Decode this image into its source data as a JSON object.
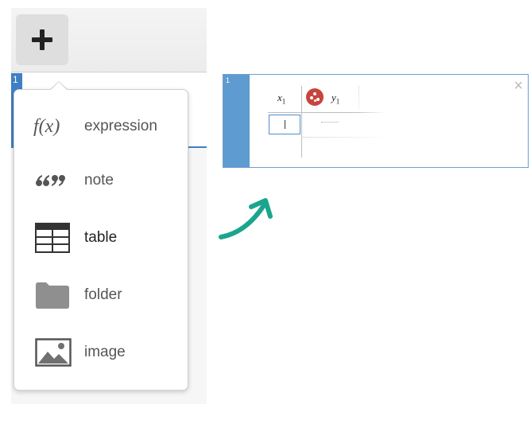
{
  "expression_list": {
    "add_button_symbol": "+",
    "first_row_number": "1"
  },
  "add_menu": {
    "items": [
      {
        "icon": "function-icon",
        "icon_text": "f(x)",
        "label": "expression"
      },
      {
        "icon": "quote-icon",
        "icon_text": "“”",
        "label": "note"
      },
      {
        "icon": "table-icon",
        "label": "table"
      },
      {
        "icon": "folder-icon",
        "label": "folder"
      },
      {
        "icon": "image-icon",
        "label": "image"
      }
    ]
  },
  "result_panel": {
    "row_number": "1",
    "close_symbol": "×",
    "table": {
      "col1_var": "x",
      "col1_sub": "1",
      "col2_var": "y",
      "col2_sub": "1"
    }
  },
  "colors": {
    "accent_blue": "#3f7fc4",
    "point_red": "#c7443f",
    "arrow_teal": "#1aa58e"
  }
}
